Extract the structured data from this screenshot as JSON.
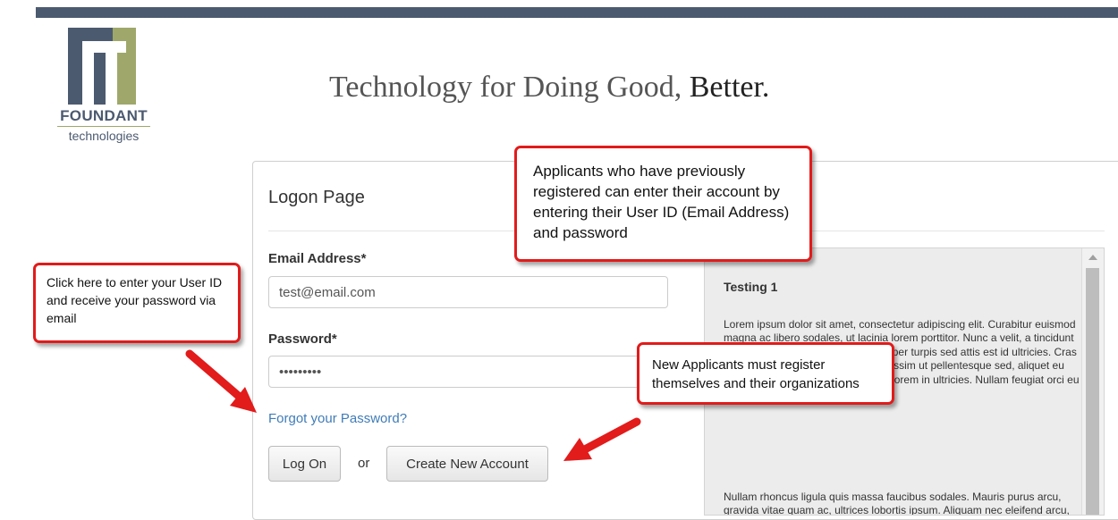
{
  "header": {
    "brand_name": "FOUNDANT",
    "brand_sub": "technologies",
    "tagline_main": "Technology for Doing Good,",
    "tagline_bold": "Better."
  },
  "colors": {
    "top_bar": "#4c5a70",
    "logo_navy": "#4c5a70",
    "logo_green": "#9fa86a",
    "link": "#3f7cb8",
    "callout_border": "#e21b1b"
  },
  "logon": {
    "title": "Logon Page",
    "email_label": "Email Address*",
    "email_value": "test@email.com",
    "password_label": "Password*",
    "password_value": "•••••••••",
    "forgot_link": "Forgot your Password?",
    "logon_button": "Log On",
    "or_text": "or",
    "create_button": "Create New Account"
  },
  "side_panel": {
    "title": "Testing 1",
    "paragraph1": "Lorem ipsum dolor sit amet, consectetur adipiscing elit. Curabitur euismod magna ac libero sodales, ut lacinia lorem porttitor. Nunc a velit, a tincidunt massa non pharetra quam ullamcorper turpis sed attis est id ultricies. Cras sed neque leo. Cras velit odio, dignissim ut pellentesque sed, aliquet eu lacus. Maecenas imperdiet facilisis lorem in ultricies. Nullam feugiat orci eu arcu feugiat vehicula.",
    "paragraph2": "Nullam rhoncus ligula quis massa faucibus sodales. Mauris purus arcu, gravida vitae quam ac, ultrices lobortis ipsum. Aliquam nec eleifend arcu, nec feugiat neque. Vestibulum vitae"
  },
  "callouts": {
    "top": "Applicants who have previously registered can enter their account by entering their User ID (Email Address) and password",
    "left": "Click here to enter your User ID and receive your password via email",
    "bottom": "New Applicants must register themselves and their organizations"
  },
  "icons": {
    "scroll_up": "chevron-up-icon",
    "arrow_left": "red-arrow-icon",
    "arrow_right": "red-arrow-icon"
  }
}
